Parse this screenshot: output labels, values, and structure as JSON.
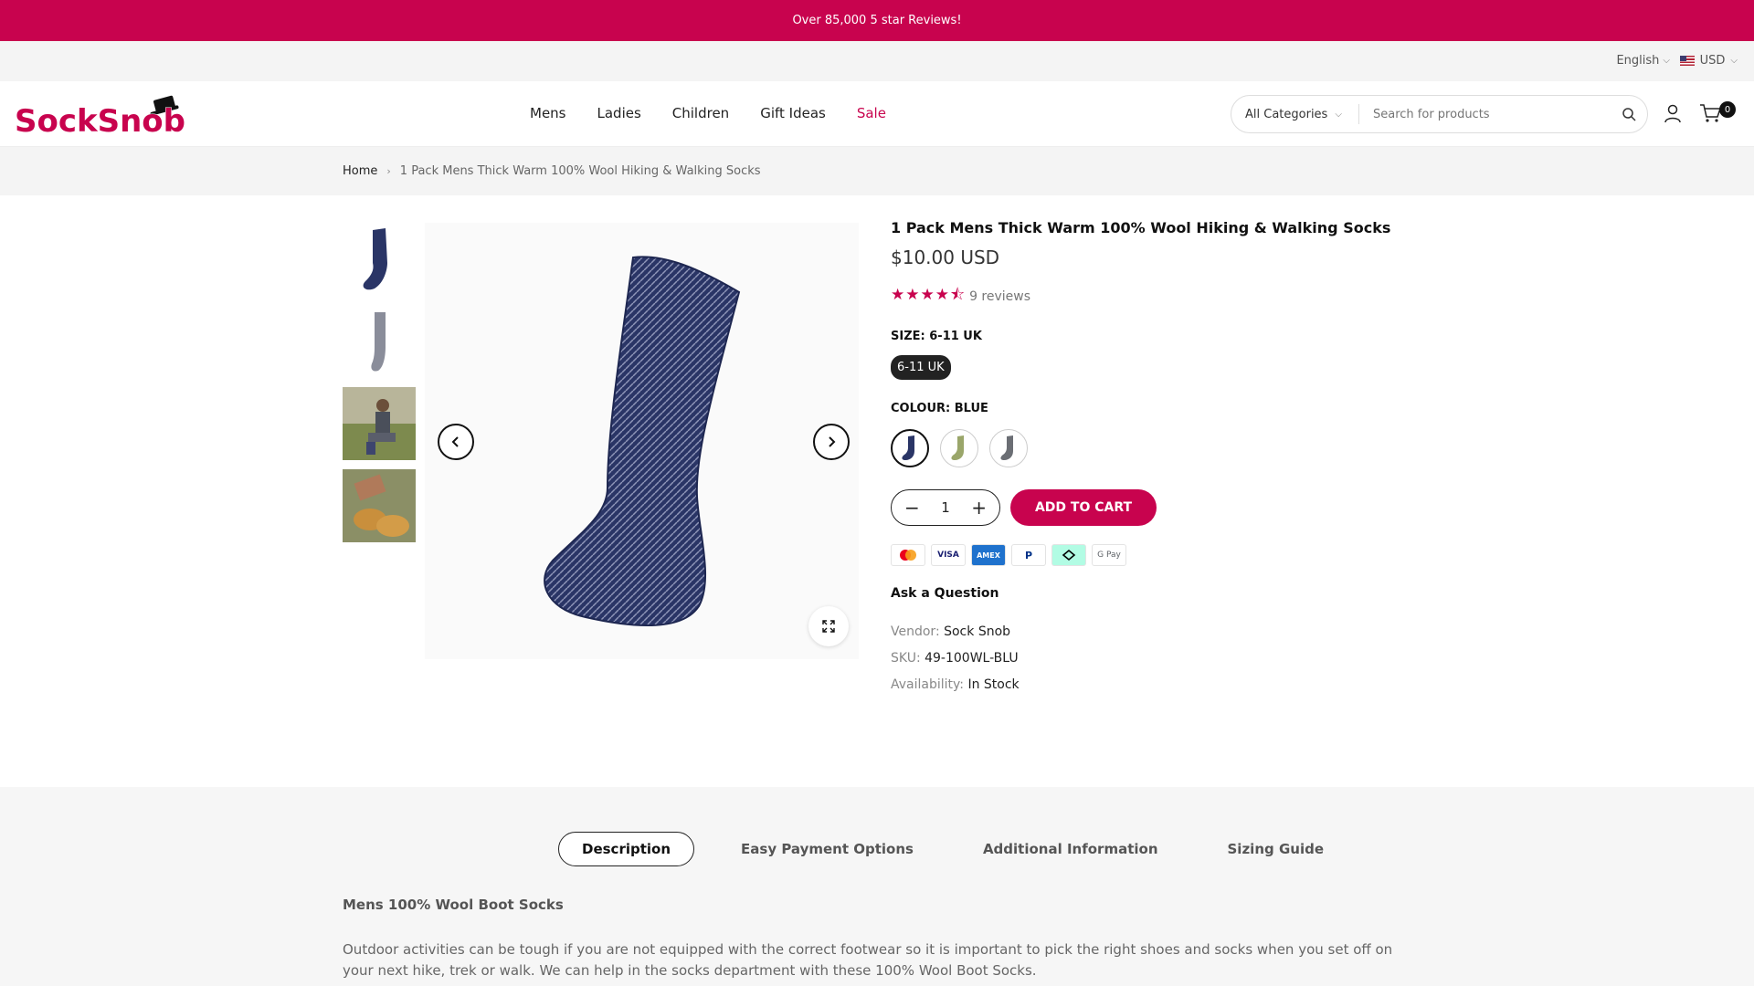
{
  "announcement": "Over 85,000 5 star Reviews!",
  "topbar": {
    "language": "English",
    "currency": "USD"
  },
  "header": {
    "logo_text": "SockSnob",
    "nav": [
      "Mens",
      "Ladies",
      "Children",
      "Gift Ideas",
      "Sale"
    ],
    "search": {
      "category": "All Categories",
      "placeholder": "Search for products"
    },
    "cart_count": "0"
  },
  "breadcrumb": {
    "home": "Home",
    "current": "1 Pack Mens Thick Warm 100% Wool Hiking & Walking Socks"
  },
  "product": {
    "title": "1 Pack Mens Thick Warm 100% Wool Hiking & Walking Socks",
    "price": "$10.00 USD",
    "rating": 4.5,
    "reviews": "9 reviews",
    "size_label": "SIZE:",
    "size_value": "6-11 UK",
    "size_option": "6-11 UK",
    "colour_label": "COLOUR:",
    "colour_value": "BLUE",
    "quantity": "1",
    "add_to_cart": "ADD TO CART",
    "ask": "Ask a Question",
    "vendor_label": "Vendor:",
    "vendor": "Sock Snob",
    "sku_label": "SKU:",
    "sku": "49-100WL-BLU",
    "availability_label": "Availability:",
    "availability": "In Stock",
    "payments": [
      "mastercard-icon",
      "visa-icon",
      "amex-icon",
      "paypal-icon",
      "afterpay-icon",
      "gpay-icon"
    ]
  },
  "tabs": [
    "Description",
    "Easy Payment Options",
    "Additional Information",
    "Sizing Guide"
  ],
  "description": {
    "title": "Mens 100% Wool Boot Socks",
    "text": "Outdoor activities can be tough if you are not equipped with the correct footwear so it is important to pick the right shoes and socks when you set off on your next hike, trek or walk. We can help in the socks department with these 100% Wool Boot Socks."
  },
  "colors": {
    "brand": "#c8034e",
    "sock_blue": "#2a3566"
  }
}
